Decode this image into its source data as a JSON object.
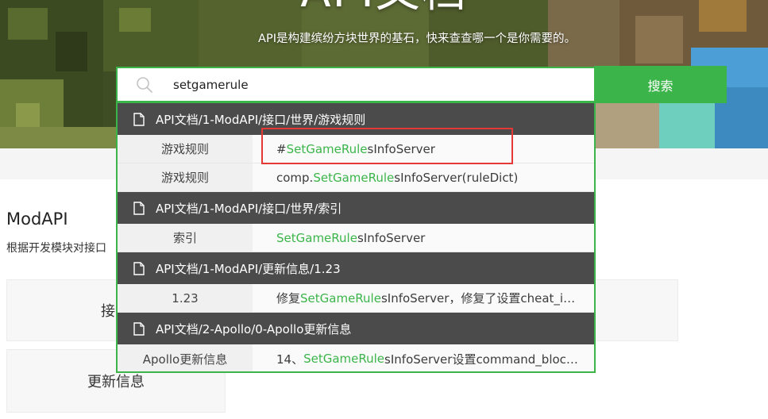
{
  "hero": {
    "title": "API文档",
    "subtitle": "API是构建缤纷方块世界的基石，快来查查哪一个是你需要的。"
  },
  "search": {
    "value": "setgamerule",
    "placeholder": "",
    "button_label": "搜索"
  },
  "results": {
    "groups": [
      {
        "header": "API文档/1-ModAPI/接口/世界/游戏规则",
        "rows": [
          {
            "category": "游戏规则",
            "prefix": "# ",
            "match": "SetGameRule",
            "suffix": "sInfoServer"
          },
          {
            "category": "游戏规则",
            "prefix": "comp.",
            "match": "SetGameRule",
            "suffix": "sInfoServer(ruleDict)"
          }
        ]
      },
      {
        "header": "API文档/1-ModAPI/接口/世界/索引",
        "rows": [
          {
            "category": "索引",
            "prefix": "",
            "match": "SetGameRule",
            "suffix": "sInfoServer"
          }
        ]
      },
      {
        "header": "API文档/1-ModAPI/更新信息/1.23",
        "rows": [
          {
            "category": "1.23",
            "prefix": "修复",
            "match": "SetGameRule",
            "suffix": "sInfoServer，修复了设置cheat_i…"
          }
        ]
      },
      {
        "header": "API文档/2-Apollo/0-Apollo更新信息",
        "rows": [
          {
            "category": "Apollo更新信息",
            "prefix": "14、",
            "match": "SetGameRule",
            "suffix": "sInfoServer设置command_bloc…"
          }
        ]
      }
    ]
  },
  "page": {
    "section_title": "ModAPI",
    "section_desc": "根据开发模块对接口",
    "card_interface": "接",
    "card_update": "更新信息"
  },
  "icons": {
    "search": "search-icon",
    "document": "document-icon"
  },
  "colors": {
    "accent": "#3bb54a",
    "group_header_bg": "#4b4b4b",
    "annotation": "#e53935"
  }
}
